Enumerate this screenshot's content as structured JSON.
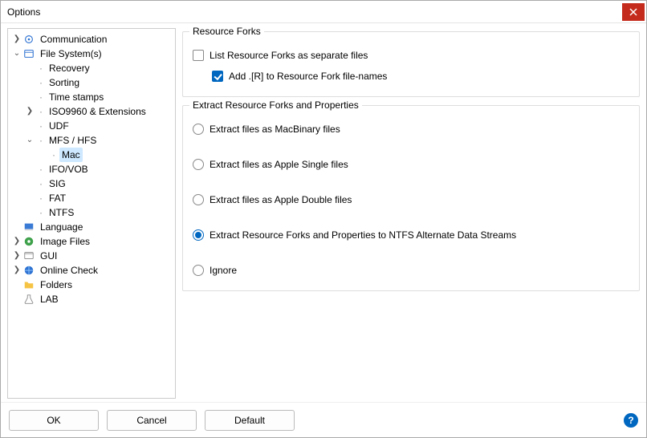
{
  "title": "Options",
  "tree": {
    "communication": "Communication",
    "filesystems": "File System(s)",
    "recovery": "Recovery",
    "sorting": "Sorting",
    "timestamps": "Time stamps",
    "iso": "ISO9960 & Extensions",
    "udf": "UDF",
    "mfs": "MFS / HFS",
    "mac": "Mac",
    "ifo": "IFO/VOB",
    "sig": "SIG",
    "fat": "FAT",
    "ntfs": "NTFS",
    "language": "Language",
    "imagefiles": "Image Files",
    "gui": "GUI",
    "onlinecheck": "Online Check",
    "folders": "Folders",
    "lab": "LAB"
  },
  "group1": {
    "legend": "Resource Forks",
    "opt1": "List Resource Forks as separate files",
    "opt2": "Add .[R] to Resource Fork file-names"
  },
  "group2": {
    "legend": "Extract Resource Forks and Properties",
    "r1": "Extract files as MacBinary files",
    "r2": "Extract files as Apple Single files",
    "r3": "Extract files as Apple Double files",
    "r4": "Extract Resource Forks and Properties to NTFS Alternate Data Streams",
    "r5": "Ignore"
  },
  "buttons": {
    "ok": "OK",
    "cancel": "Cancel",
    "default": "Default"
  }
}
